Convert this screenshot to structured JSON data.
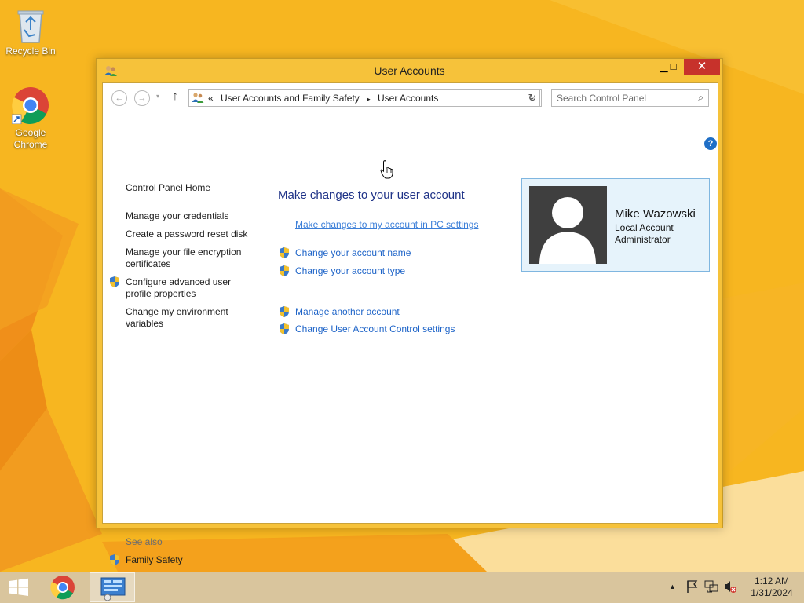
{
  "desktop": {
    "icons": [
      {
        "label": "Recycle Bin"
      },
      {
        "label": "Google Chrome"
      }
    ]
  },
  "window": {
    "title": "User Accounts",
    "controls": {
      "minimize": "▁",
      "maximize": "□",
      "close": "✕"
    }
  },
  "navbar": {
    "back": "←",
    "forward": "→",
    "recent": "▾",
    "up": "↑",
    "breadcrumb_prefix": "«",
    "breadcrumbs": [
      "User Accounts and Family Safety",
      "User Accounts"
    ],
    "separator": "▸",
    "address_dropdown": "⌄",
    "refresh": "↻",
    "search_placeholder": "Search Control Panel",
    "search_icon": "⌕"
  },
  "help": "?",
  "sidebar": {
    "home": "Control Panel Home",
    "items": [
      {
        "label": "Manage your credentials",
        "shield": false
      },
      {
        "label": "Create a password reset disk",
        "shield": false
      },
      {
        "label": "Manage your file encryption certificates",
        "shield": false
      },
      {
        "label": "Configure advanced user profile properties",
        "shield": true
      },
      {
        "label": "Change my environment variables",
        "shield": false
      }
    ],
    "see_also_heading": "See also",
    "see_also": [
      {
        "label": "Family Safety",
        "shield": true
      }
    ]
  },
  "main": {
    "title": "Make changes to your user account",
    "tasks": [
      {
        "label": "Make changes to my account in PC settings",
        "shield": false
      },
      {
        "label": "Change your account name",
        "shield": true
      },
      {
        "label": "Change your account type",
        "shield": true
      },
      {
        "label": "Manage another account",
        "shield": true
      },
      {
        "label": "Change User Account Control settings",
        "shield": true
      }
    ]
  },
  "account": {
    "name": "Mike Wazowski",
    "type": "Local Account",
    "role": "Administrator"
  },
  "taskbar": {
    "clock_time": "1:12 AM",
    "clock_date": "1/31/2024"
  },
  "colors": {
    "wallpaper": "#f6b21e",
    "link": "#1e64c8",
    "title": "#1e3287",
    "close": "#c7322b"
  }
}
